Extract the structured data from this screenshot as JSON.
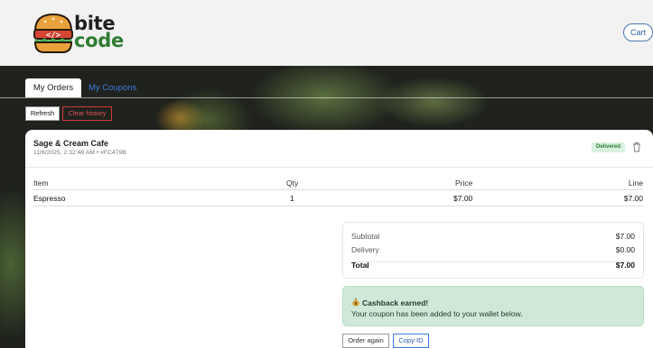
{
  "brand": {
    "line1": "bite",
    "line2": "code"
  },
  "header": {
    "cart_label": "Cart"
  },
  "tabs": [
    {
      "label": "My Orders",
      "active": true
    },
    {
      "label": "My Coupons",
      "active": false
    }
  ],
  "actions": {
    "refresh_label": "Refresh",
    "clear_label": "Clear history"
  },
  "order": {
    "store": "Sage & Cream Cafe",
    "meta": "11/6/2025, 2:32:48 AM • #FC479B",
    "status": "Delivered",
    "columns": {
      "item": "Item",
      "qty": "Qty",
      "price": "Price",
      "line": "Line"
    },
    "items": [
      {
        "item": "Espresso",
        "qty": "1",
        "price": "$7.00",
        "line": "$7.00"
      }
    ],
    "summary": {
      "subtotal_label": "Subtotal",
      "subtotal": "$7.00",
      "delivery_label": "Delivery",
      "delivery": "$0.00",
      "total_label": "Total",
      "total": "$7.00"
    },
    "cashback": {
      "title": "Cashback earned!",
      "text": "Your coupon has been added to your wallet below."
    },
    "buttons": {
      "order_again": "Order again",
      "copy_id": "Copy ID"
    }
  },
  "colors": {
    "brand_green": "#2e7d32",
    "link_blue": "#3d7be0",
    "danger": "#d23a3a",
    "cashback_bg": "#cfe9d8",
    "badge_bg": "#d9f2df"
  },
  "icons": {
    "logo": "burger-code-icon",
    "delete": "trash-icon",
    "cashback": "money-bag-icon"
  }
}
